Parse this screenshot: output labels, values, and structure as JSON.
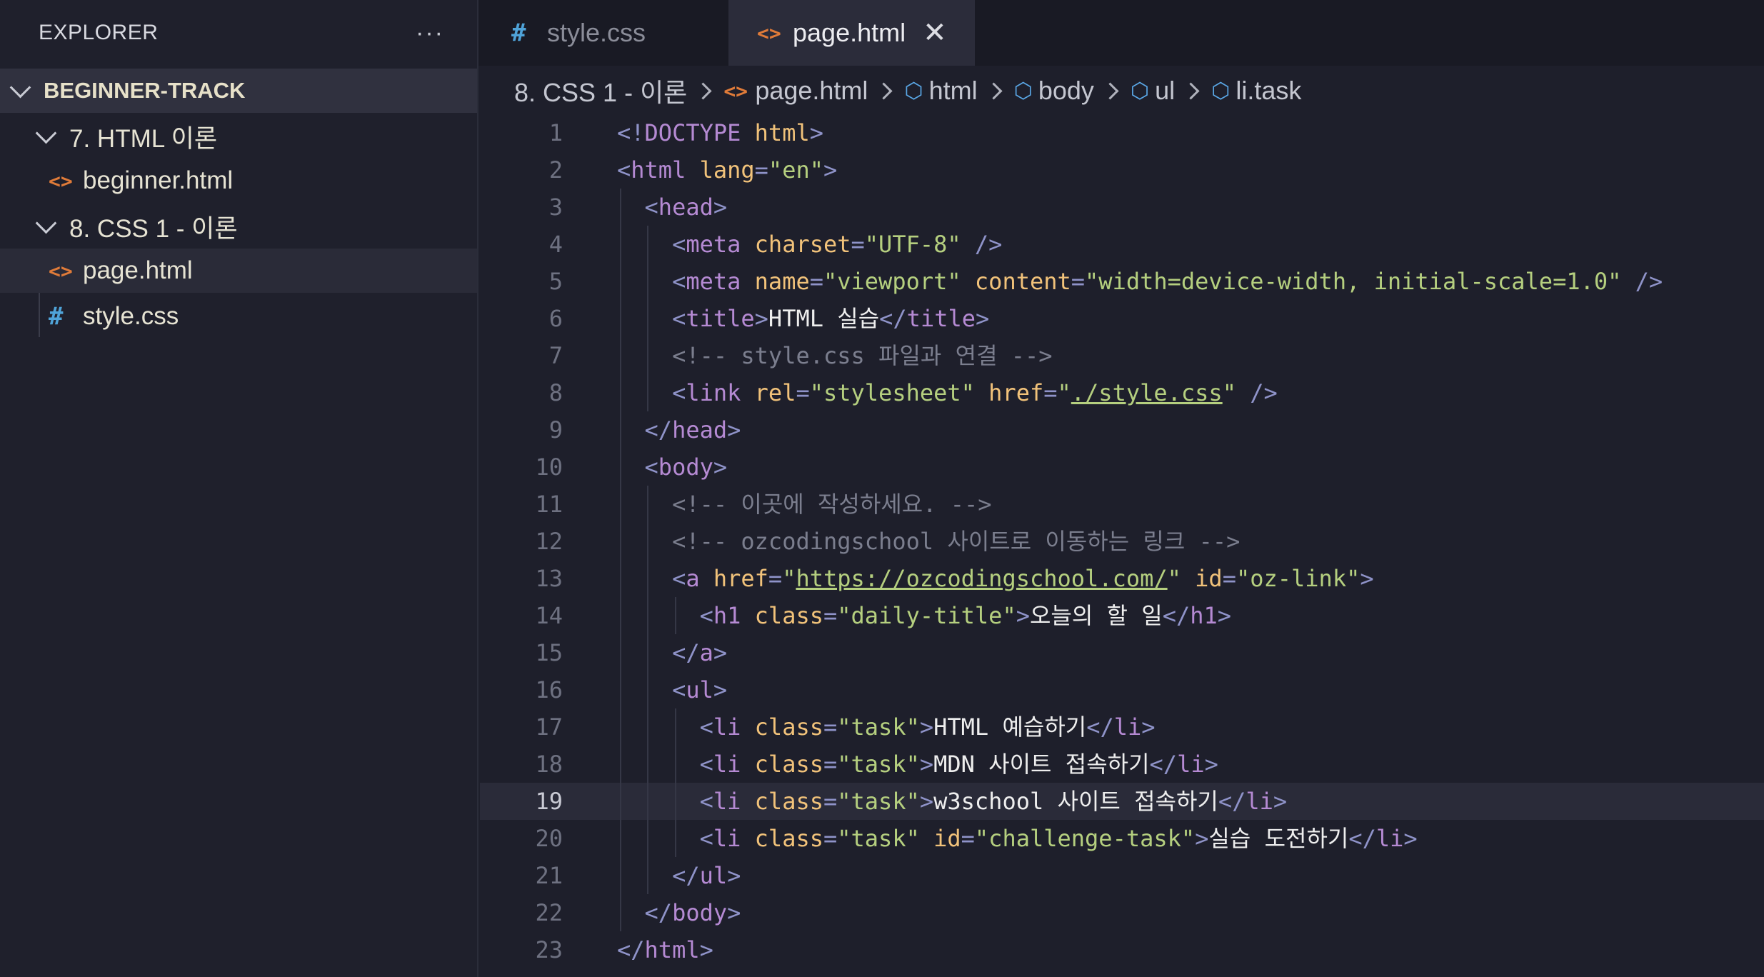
{
  "sidebar": {
    "title": "EXPLORER",
    "more": "···",
    "root": "BEGINNER-TRACK",
    "items": [
      {
        "label": "7. HTML 이론",
        "type": "folder"
      },
      {
        "label": "beginner.html",
        "type": "html"
      },
      {
        "label": "8. CSS 1 - 이론",
        "type": "folder"
      },
      {
        "label": "page.html",
        "type": "html"
      },
      {
        "label": "style.css",
        "type": "css"
      }
    ]
  },
  "tabs": [
    {
      "label": "style.css",
      "icon": "#"
    },
    {
      "label": "page.html",
      "icon": "<>",
      "close": "✕"
    }
  ],
  "breadcrumb": [
    "8. CSS 1 - 이론",
    "page.html",
    "html",
    "body",
    "ul",
    "li.task"
  ],
  "editor": {
    "current_line": 19,
    "lines": [
      "<!DOCTYPE html>",
      "<html lang=\"en\">",
      "  <head>",
      "    <meta charset=\"UTF-8\" />",
      "    <meta name=\"viewport\" content=\"width=device-width, initial-scale=1.0\" />",
      "    <title>HTML 실습</title>",
      "    <!-- style.css 파일과 연결 -->",
      "    <link rel=\"stylesheet\" href=\"./style.css\" />",
      "  </head>",
      "  <body>",
      "    <!-- 이곳에 작성하세요. -->",
      "    <!-- ozcodingschool 사이트로 이동하는 링크 -->",
      "    <a href=\"https://ozcodingschool.com/\" id=\"oz-link\">",
      "      <h1 class=\"daily-title\">오늘의 할 일</h1>",
      "    </a>",
      "    <ul>",
      "      <li class=\"task\">HTML 예습하기</li>",
      "      <li class=\"task\">MDN 사이트 접속하기</li>",
      "      <li class=\"task\">w3school 사이트 접속하기</li>",
      "      <li class=\"task\" id=\"challenge-task\">실습 도전하기</li>",
      "    </ul>",
      "  </body>",
      "</html>"
    ]
  }
}
